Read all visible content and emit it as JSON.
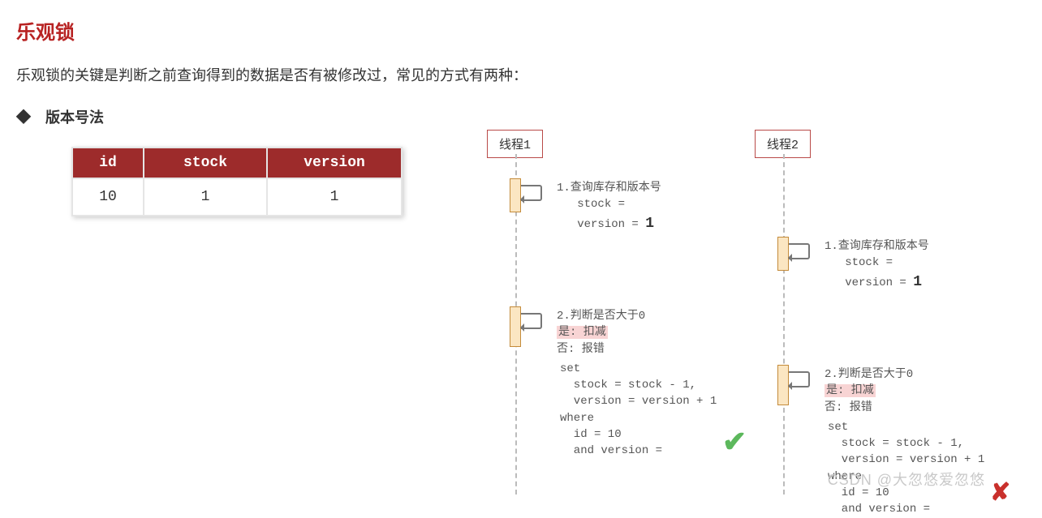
{
  "title": "乐观锁",
  "description": "乐观锁的关键是判断之前查询得到的数据是否有被修改过，常见的方式有两种：",
  "section_label": "◆　版本号法",
  "table": {
    "headers": [
      "id",
      "stock",
      "version"
    ],
    "row": [
      "10",
      "1",
      "1"
    ]
  },
  "threads": {
    "t1": "线程1",
    "t2": "线程2"
  },
  "steps": {
    "t1_s1": {
      "title": "1.查询库存和版本号",
      "line1": "stock =",
      "line2": "version =",
      "val": "1"
    },
    "t2_s1": {
      "title": "1.查询库存和版本号",
      "line1": "stock =",
      "line2": "version =",
      "val": "1"
    },
    "t1_s2": {
      "title": "2.判断是否大于0",
      "yes": "是: 扣减",
      "no": "否: 报错",
      "code": "set\n  stock = stock - 1,\n  version = version + 1\nwhere\n  id = 10\n  and version ="
    },
    "t2_s2": {
      "title": "2.判断是否大于0",
      "yes": "是: 扣减",
      "no": "否: 报错",
      "code": "set\n  stock = stock - 1,\n  version = version + 1\nwhere\n  id = 10\n  and version ="
    }
  },
  "watermark": "CSDN @大忽悠爱忽悠",
  "icons": {
    "check": "✔",
    "cross": "✘"
  }
}
